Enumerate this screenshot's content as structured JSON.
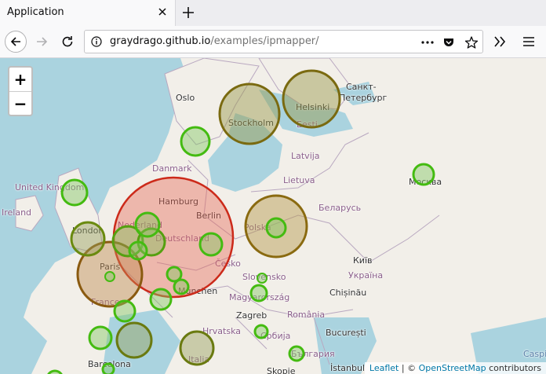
{
  "tab": {
    "title": "Application"
  },
  "urlbar": {
    "host": "graydrago.github.io",
    "path": "/examples/ipmapper/"
  },
  "zoom": {
    "in_label": "+",
    "out_label": "−"
  },
  "attribution": {
    "leaflet": "Leaflet",
    "sep": " | © ",
    "osm": "OpenStreetMap",
    "suffix": " contributors"
  },
  "labels": {
    "oslo": "Oslo",
    "stockholm": "Stockholm",
    "helsinki": "Helsinki",
    "eesti": "Eesti",
    "spb": "Санкт-\nПетербург",
    "spb1": "Санкт-",
    "spb2": "Петербург",
    "danmark": "Danmark",
    "latvija": "Latvija",
    "lietuva": "Lietuva",
    "moskva": "Москва",
    "uk": "United Kingdom",
    "ireland": "Ireland",
    "hamburg": "Hamburg",
    "berlin": "Berlin",
    "nederland": "Nederland",
    "london": "London",
    "deutschland": "Deutschland",
    "polska": "Polska",
    "belarus": "Беларусь",
    "cesko": "Česko",
    "paris": "Paris",
    "kyiv": "Київ",
    "ukraina": "Україна",
    "slovensko": "Slovensko",
    "munchen": "München",
    "chisinau": "Chișinău",
    "france": "France",
    "magyarorszag": "Magyarország",
    "zagreb": "Zagreb",
    "romania": "România",
    "hrvatska": "Hrvatska",
    "srbija": "Србија",
    "bucuresti": "București",
    "balgaria": "България",
    "barcelona": "Barcelona",
    "italia": "Italia",
    "skopje": "Skopje",
    "istanbul": "İstanbul",
    "caspian": "Caspi"
  },
  "colors": {
    "green": "#44bb11",
    "olive": "#7a6a10",
    "brown": "#8a5a10",
    "red": "#cc2a1a"
  }
}
